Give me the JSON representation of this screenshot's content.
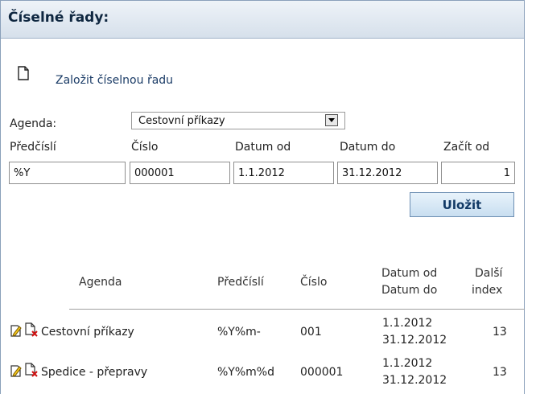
{
  "panel": {
    "title": "Číselné řady:"
  },
  "new_series": {
    "label": "Založit číselnou řadu"
  },
  "form": {
    "agenda_label": "Agenda:",
    "agenda_value": "Cestovní příkazy",
    "prefix_label": "Předčíslí",
    "number_label": "Číslo",
    "date_from_label": "Datum od",
    "date_to_label": "Datum do",
    "start_label": "Začít od",
    "prefix_value": "%Y",
    "number_value": "000001",
    "date_from_value": "1.1.2012",
    "date_to_value": "31.12.2012",
    "start_value": "1",
    "save_label": "Uložit"
  },
  "table": {
    "headers": {
      "agenda": "Agenda",
      "prefix": "Předčíslí",
      "number": "Číslo",
      "date_from": "Datum od",
      "date_to": "Datum do",
      "next_1": "Další",
      "next_2": "index"
    },
    "rows": [
      {
        "agenda": "Cestovní příkazy",
        "prefix": "%Y%m-",
        "number": "001",
        "date_from": "1.1.2012",
        "date_to": "31.12.2012",
        "next_index": "13"
      },
      {
        "agenda": "Spedice - přepravy",
        "prefix": "%Y%m%d",
        "number": "000001",
        "date_from": "1.1.2012",
        "date_to": "31.12.2012",
        "next_index": "13"
      }
    ]
  },
  "icons": {
    "new": "document-icon",
    "edit": "edit-icon",
    "delete": "delete-document-icon"
  }
}
